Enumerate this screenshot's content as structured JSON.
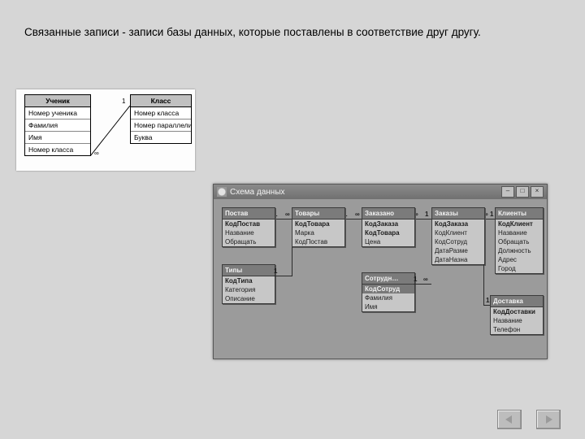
{
  "caption": "Связанные записи - записи базы данных, которые поставлены в соответствие друг другу.",
  "dia1": {
    "left": {
      "title": "Ученик",
      "rows": [
        "Номер ученика",
        "Фамилия",
        "Имя",
        "Номер класса"
      ]
    },
    "right": {
      "title": "Класс",
      "rows": [
        "Номер класса",
        "Номер параллели",
        "Буква"
      ]
    },
    "card_many": "∞",
    "card_one": "1"
  },
  "win": {
    "title": "Схема данных",
    "btn_min": "–",
    "btn_max": "□",
    "btn_close": "×",
    "boxes": {
      "postav": {
        "title": "Постав",
        "fields": [
          "КодПостав",
          "Название",
          "Обращать"
        ]
      },
      "tipy": {
        "title": "Типы",
        "fields": [
          "КодТипа",
          "Категория",
          "Описание"
        ]
      },
      "tovary": {
        "title": "Товары",
        "fields": [
          "КодТовара",
          "Марка",
          "КодПостав"
        ]
      },
      "zakazano": {
        "title": "Заказано",
        "fields": [
          "КодЗаказа",
          "КодТовара",
          "Цена"
        ]
      },
      "sotrudn": {
        "title": "Сотрудн…",
        "fields": [
          "КодСотруд",
          "Фамилия",
          "Имя"
        ]
      },
      "zakazy": {
        "title": "Заказы",
        "fields": [
          "КодЗаказа",
          "КодКлиент",
          "КодСотруд",
          "ДатаРазме",
          "ДатаНазна"
        ]
      },
      "klienty": {
        "title": "Клиенты",
        "fields": [
          "КодКлиент",
          "Название",
          "Обращать",
          "Должность",
          "Адрес",
          "Город"
        ]
      },
      "dostavka": {
        "title": "Доставка",
        "fields": [
          "КодДоставки",
          "Название",
          "Телефон"
        ]
      }
    },
    "one": "1",
    "inf": "∞"
  }
}
